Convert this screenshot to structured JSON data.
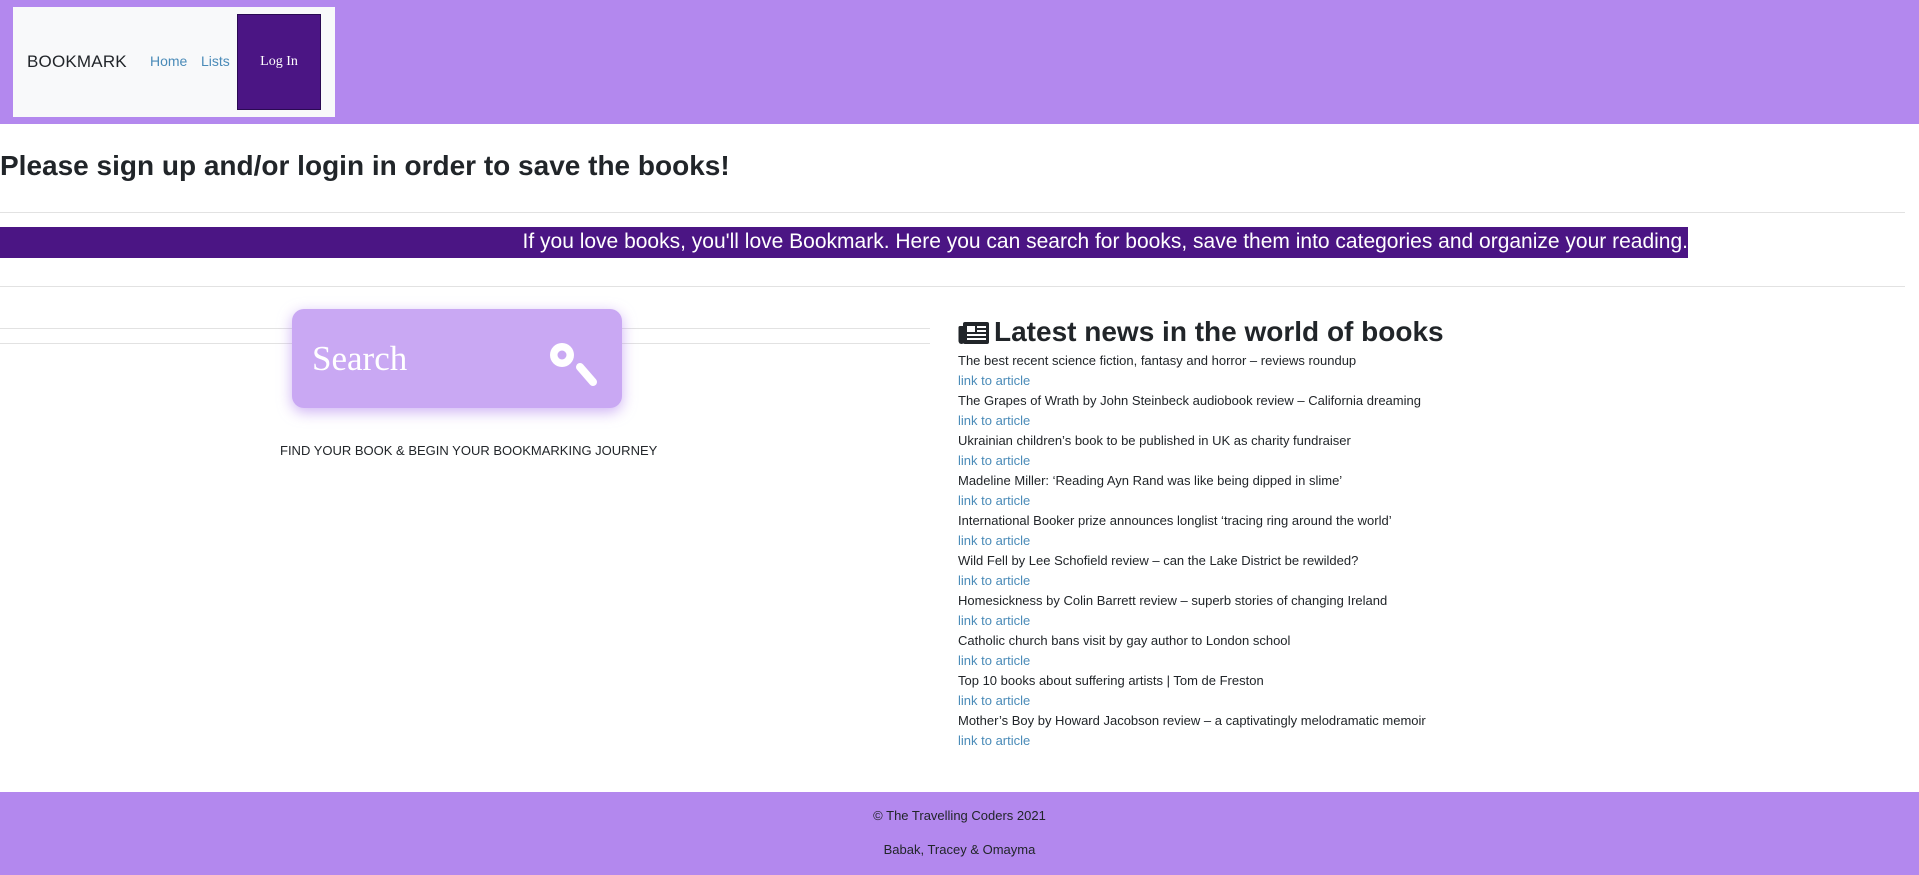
{
  "nav": {
    "brand": "BOOKMARK",
    "home": "Home",
    "lists": "Lists",
    "login": "Log In"
  },
  "main": {
    "signup_message": "Please sign up and/or login in order to save the books!",
    "banner": "If you love books, you'll love Bookmark. Here you can search for books, save them into categories and organize your reading.",
    "search_placeholder": "Search",
    "tagline": "FIND YOUR BOOK & BEGIN YOUR BOOKMARKING JOURNEY"
  },
  "news": {
    "heading": "Latest news in the world of books",
    "items": [
      {
        "title": "The best recent science fiction, fantasy and horror – reviews roundup",
        "link": "link to article"
      },
      {
        "title": "The Grapes of Wrath by John Steinbeck audiobook review – California dreaming",
        "link": "link to article"
      },
      {
        "title": "Ukrainian children’s book to be published in UK as charity fundraiser",
        "link": "link to article"
      },
      {
        "title": "Madeline Miller: ‘Reading Ayn Rand was like being dipped in slime’",
        "link": "link to article"
      },
      {
        "title": "International Booker prize announces longlist ‘tracing ring around the world’",
        "link": "link to article"
      },
      {
        "title": "Wild Fell by Lee Schofield review – can the Lake District be rewilded?",
        "link": "link to article"
      },
      {
        "title": "Homesickness by Colin Barrett review – superb stories of changing Ireland",
        "link": "link to article"
      },
      {
        "title": "Catholic church bans visit by gay author to London school",
        "link": "link to article"
      },
      {
        "title": "Top 10 books about suffering artists | Tom de Freston",
        "link": "link to article"
      },
      {
        "title": "Mother’s Boy by Howard Jacobson review – a captivatingly melodramatic memoir",
        "link": "link to article"
      }
    ]
  },
  "footer": {
    "copyright": "© The Travelling Coders 2021",
    "authors": "Babak, Tracey & Omayma"
  },
  "colors": {
    "header_bg": "#b388ee",
    "accent_dark": "#4b1584",
    "search_card": "#c9a8f3",
    "link": "#4a8bb8"
  },
  "icons": [
    "search-icon",
    "newspaper-icon"
  ]
}
